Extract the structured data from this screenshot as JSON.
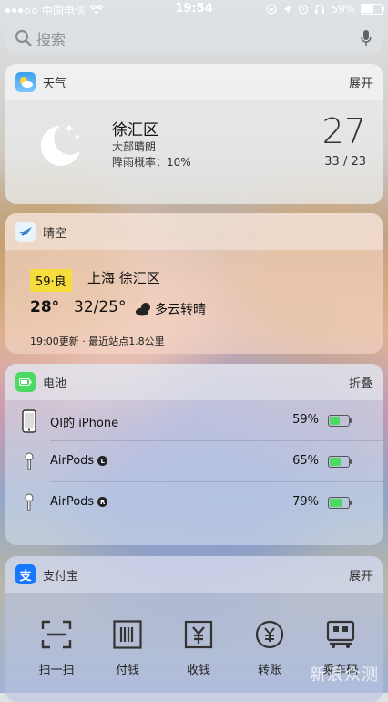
{
  "status_bar": {
    "carrier": "中国电信",
    "time": "19:54",
    "battery": "59%"
  },
  "search": {
    "placeholder": "搜索"
  },
  "weather_widget": {
    "app_name": "天气",
    "action": "展开",
    "location": "徐汇区",
    "condition": "大部晴朗",
    "rain_chance": "降雨概率：10%",
    "temperature": "27",
    "high_low": "33 / 23"
  },
  "qingkong_widget": {
    "app_name": "晴空",
    "aqi": "59·良",
    "location": "上海 徐汇区",
    "temperature": "28°",
    "range": "32/25°",
    "weather": "多云转晴",
    "update": "19:00更新 · 最近站点1.8公里"
  },
  "battery_widget": {
    "app_name": "电池",
    "action": "折叠",
    "devices": [
      {
        "name": "QI的 iPhone",
        "badge": "",
        "percent": "59%",
        "level": 0.59
      },
      {
        "name": "AirPods",
        "badge": "L",
        "percent": "65%",
        "level": 0.65
      },
      {
        "name": "AirPods",
        "badge": "R",
        "percent": "79%",
        "level": 0.79
      }
    ]
  },
  "alipay_widget": {
    "app_name": "支付宝",
    "action": "展开",
    "actions": [
      "扫一扫",
      "付钱",
      "收钱",
      "转账",
      "乘车码"
    ]
  },
  "watermark": "新浪众测",
  "colors": {
    "battery_green": "#4cd964",
    "aqi_yellow": "#f6dd3c",
    "alipay_blue": "#1677ff"
  }
}
